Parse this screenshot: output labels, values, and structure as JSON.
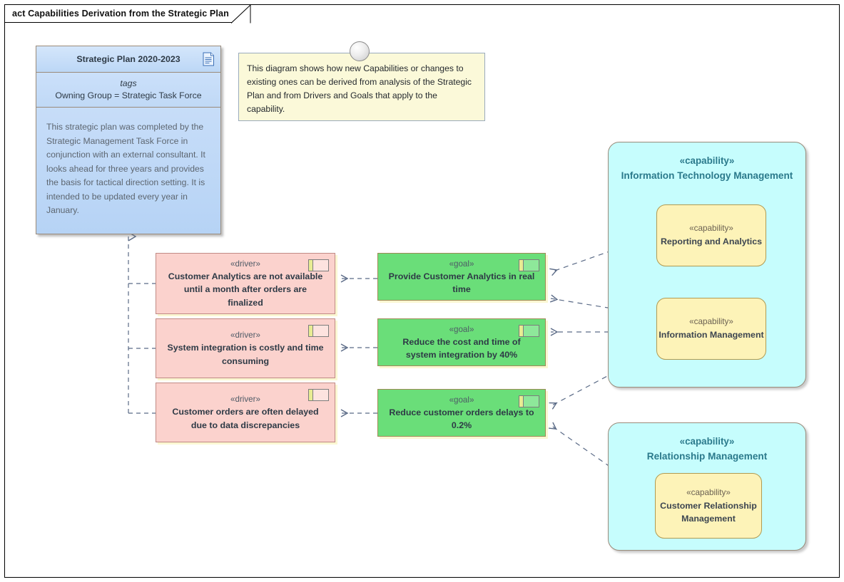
{
  "diagram": {
    "frame_label": "act Capabilities Derivation from the Strategic Plan",
    "colors": {
      "driver_fill": "#fbd2cd",
      "goal_fill": "#6ade79",
      "capability_group_fill": "#c6fdfd",
      "capability_inner_fill": "#fdf3b8",
      "note_fill": "#fbf9d9",
      "plan_fill": "#c3dbf7",
      "connector": "#5a6a86"
    }
  },
  "strategic_plan": {
    "title": "Strategic Plan 2020-2023",
    "icon": "document-icon",
    "tags_label": "tags",
    "tag_row": "Owning Group = Strategic Task Force",
    "notes": "This strategic plan was completed by the Strategic Management Task Force in conjunction with an external consultant. It looks ahead for three years and provides the basis for tactical direction setting. It is intended to be updated every year in January."
  },
  "note": {
    "text": "This diagram shows how new Capabilities or changes to existing ones can be derived from analysis of the Strategic Plan and from Drivers and Goals that apply to the capability."
  },
  "drivers": [
    {
      "stereotype": "«driver»",
      "name": "Customer Analytics are not available until a month after orders are finalized"
    },
    {
      "stereotype": "«driver»",
      "name": "System integration is costly and time consuming"
    },
    {
      "stereotype": "«driver»",
      "name": "Customer orders are often delayed due to data discrepancies"
    }
  ],
  "goals": [
    {
      "stereotype": "«goal»",
      "name": "Provide Customer Analytics in real time"
    },
    {
      "stereotype": "«goal»",
      "name": "Reduce the cost and time of system integration by 40%"
    },
    {
      "stereotype": "«goal»",
      "name": "Reduce customer orders delays to 0.2%"
    }
  ],
  "capability_groups": [
    {
      "stereotype": "«capability»",
      "name": "Information Technology Management",
      "children": [
        {
          "stereotype": "«capability»",
          "name": "Reporting and Analytics"
        },
        {
          "stereotype": "«capability»",
          "name": "Information Management"
        }
      ]
    },
    {
      "stereotype": "«capability»",
      "name": "Relationship Management",
      "children": [
        {
          "stereotype": "«capability»",
          "name": "Customer Relationship Management"
        }
      ]
    }
  ]
}
